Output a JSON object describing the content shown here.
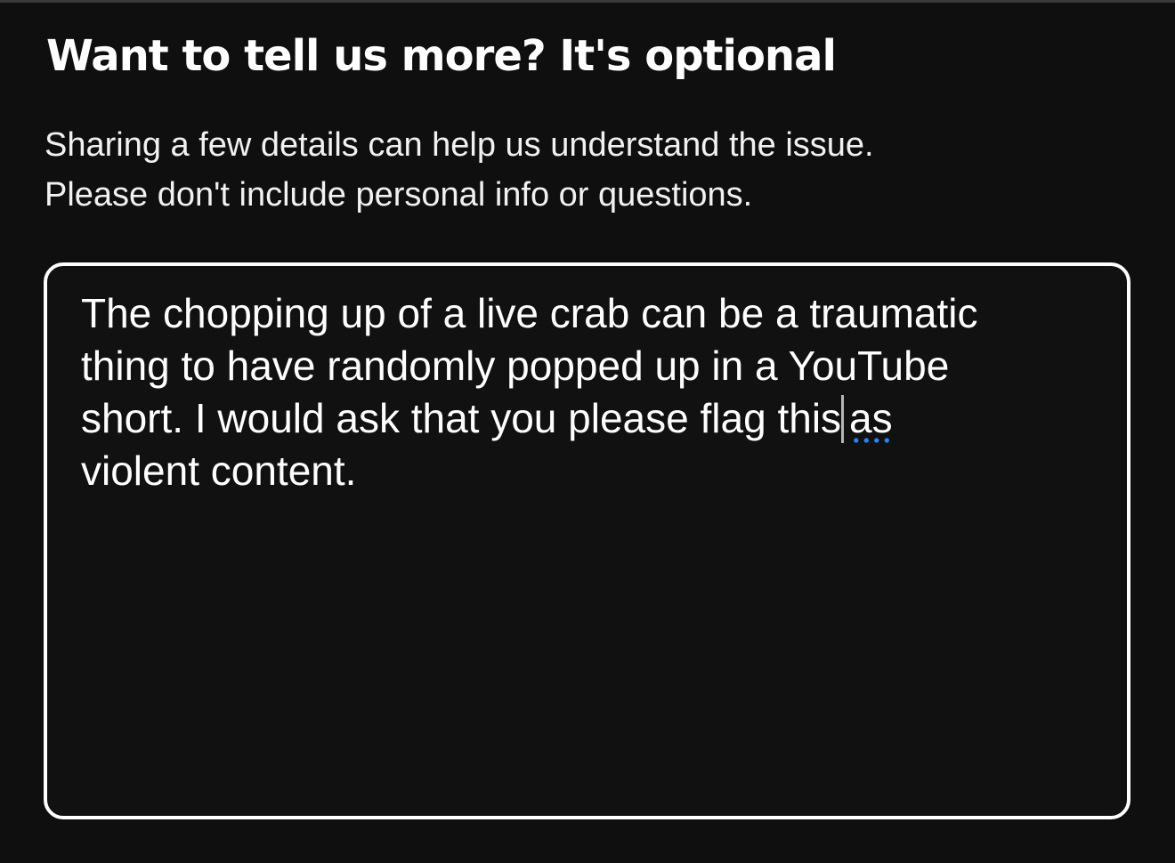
{
  "dialog": {
    "title": "Want to tell us more? It's optional",
    "description_lines": [
      "Sharing a few details can help us understand the issue.",
      "Please don't include personal info or questions."
    ]
  },
  "details_field": {
    "lines": [
      "The chopping up of a live crab can be a traumatic",
      "thing to have randomly popped up in a YouTube",
      "short. I would ask that you please flag this",
      "violent content."
    ],
    "flagged_word": "as",
    "spellcheck_underline_color": "#1e88ff"
  },
  "colors": {
    "background": "#0f0f0f",
    "text": "#ffffff",
    "field_border": "#ffffff",
    "caret": "#b5b5b5"
  }
}
